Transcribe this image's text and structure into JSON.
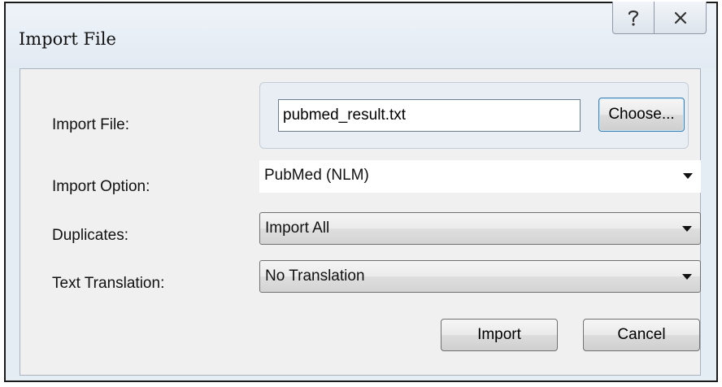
{
  "window": {
    "title": "Import File",
    "help_glyph": "?",
    "close_glyph": "✕"
  },
  "form": {
    "import_file_label": "Import File:",
    "import_file_value": "pubmed_result.txt",
    "choose_label": "Choose...",
    "import_option_label": "Import Option:",
    "import_option_value": "PubMed (NLM)",
    "duplicates_label": "Duplicates:",
    "duplicates_value": "Import All",
    "text_translation_label": "Text Translation:",
    "text_translation_value": "No Translation"
  },
  "buttons": {
    "import_label": "Import",
    "cancel_label": "Cancel"
  },
  "icons": {
    "help": "help-icon",
    "close": "close-icon",
    "dropdown": "chevron-down-icon"
  }
}
